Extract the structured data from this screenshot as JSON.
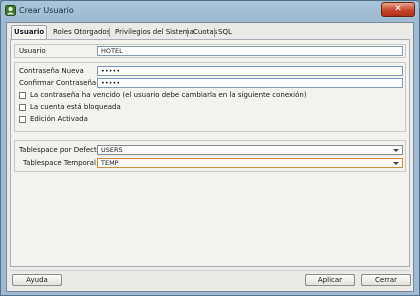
{
  "window": {
    "title": "Crear Usuario",
    "close_label": "✕"
  },
  "tabs": [
    {
      "label": "Usuario",
      "active": true
    },
    {
      "label": "Roles Otorgados"
    },
    {
      "label": "Privilegios del Sistema"
    },
    {
      "label": "Cuotas"
    },
    {
      "label": "SQL"
    }
  ],
  "user": {
    "label": "Usuario",
    "value": "HOTEL"
  },
  "password": {
    "new_label": "Contraseña Nueva",
    "new_value": "•••••",
    "confirm_label": "Confirmar Contraseña",
    "confirm_value": "•••••"
  },
  "options": [
    {
      "label": "La contraseña ha vencido (el usuario debe cambiarla en la siguiente conexión)",
      "checked": false
    },
    {
      "label": "La cuenta está bloqueada",
      "checked": false
    },
    {
      "label": "Edición Activada",
      "checked": false
    }
  ],
  "tablespace": {
    "default_label": "Tablespace por Defecto",
    "default_value": "USERS",
    "temp_label": "Tablespace Temporal",
    "temp_value": "TEMP"
  },
  "buttons": {
    "help": "Ayuda",
    "apply": "Aplicar",
    "close": "Cerrar"
  }
}
